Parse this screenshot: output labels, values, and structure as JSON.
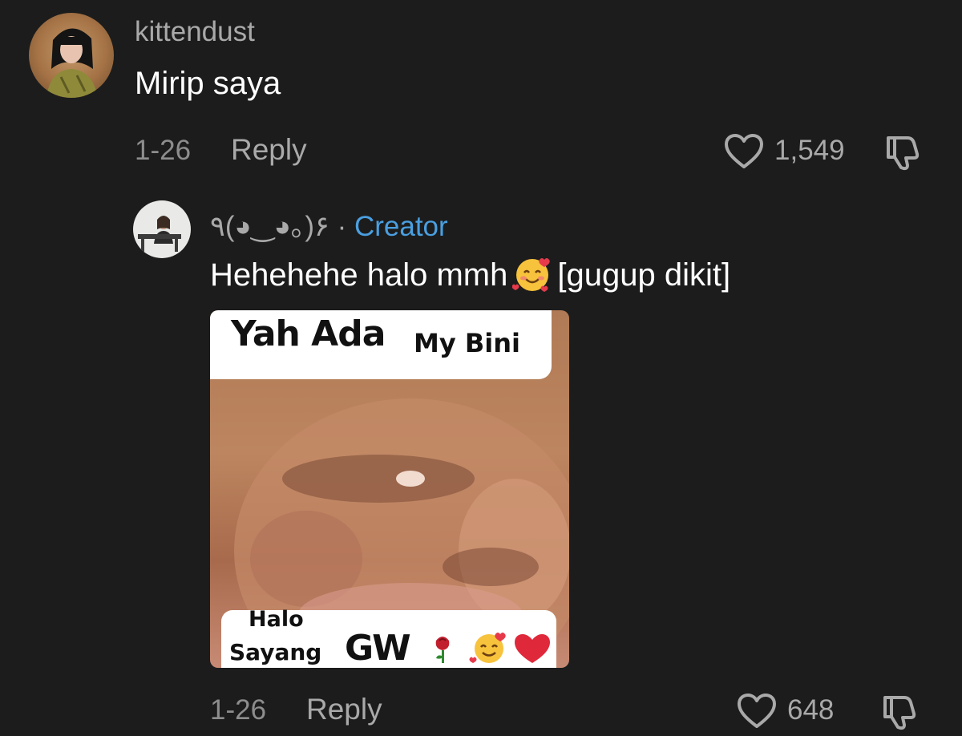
{
  "comment": {
    "username": "kittendust",
    "text": "Mirip saya",
    "date": "1-26",
    "reply_label": "Reply",
    "like_count": "1,549",
    "avatar_icon": "user-avatar-photo",
    "like_icon": "heart-outline-icon",
    "dislike_icon": "thumbs-down-outline-icon"
  },
  "reply": {
    "username": "٩(◕‿◕｡)۶",
    "separator": "·",
    "badge": "Creator",
    "text_before": "Hehehehe halo mmh",
    "text_after": "[gugup dikit]",
    "text_emoji_icon": "smiling-face-with-hearts-emoji",
    "date": "1-26",
    "reply_label": "Reply",
    "like_count": "648",
    "sticker": {
      "top_big": "Yah Ada",
      "top_small": "My Bini",
      "bottom_line1": "Halo",
      "bottom_line2": "Sayang",
      "bottom_big": "GW",
      "emoji_icons": [
        "rose-emoji",
        "smiling-face-with-hearts-emoji",
        "red-heart-emoji"
      ]
    }
  },
  "colors": {
    "background": "#1c1c1c",
    "secondary_text": "#a9a9a9",
    "creator_badge": "#4a9fe0"
  }
}
